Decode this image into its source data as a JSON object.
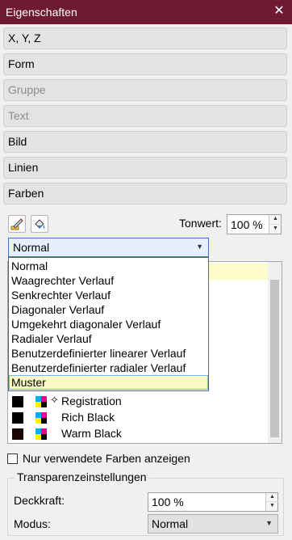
{
  "window": {
    "title": "Eigenschaften",
    "close_glyph": "✕"
  },
  "sections": [
    {
      "label": "X, Y, Z",
      "enabled": true
    },
    {
      "label": "Form",
      "enabled": true
    },
    {
      "label": "Gruppe",
      "enabled": false
    },
    {
      "label": "Text",
      "enabled": false
    },
    {
      "label": "Bild",
      "enabled": true
    },
    {
      "label": "Linien",
      "enabled": true
    },
    {
      "label": "Farben",
      "enabled": true
    }
  ],
  "colors_panel": {
    "tools": [
      {
        "name": "line-color-icon"
      },
      {
        "name": "fill-color-icon"
      }
    ],
    "tonwert": {
      "label": "Tonwert:",
      "value": "100 %"
    },
    "gradient_type": {
      "selected": "Normal",
      "options": [
        "Normal",
        "Waagrechter Verlauf",
        "Senkrechter Verlauf",
        "Diagonaler Verlauf",
        "Umgekehrt diagonaler Verlauf",
        "Radialer Verlauf",
        "Benutzerdefinierter linearer Verlauf",
        "Benutzerdefinierter radialer Verlauf",
        "Muster"
      ],
      "highlighted": "Muster"
    },
    "color_list": [
      {
        "name": "Registration",
        "swatch": "#000000",
        "registration": true,
        "reg_glyph": "✧"
      },
      {
        "name": "Rich Black",
        "swatch": "#000000",
        "registration": false
      },
      {
        "name": "Warm Black",
        "swatch": "#1a0505",
        "registration": false
      }
    ],
    "show_unused": {
      "label": "Nur verwendete Farben anzeigen",
      "checked": false
    }
  },
  "transparency": {
    "legend": "Transparenzeinstellungen",
    "opacity": {
      "label": "Deckkraft:",
      "value": "100 %"
    },
    "mode": {
      "label": "Modus:",
      "value": "Normal"
    }
  },
  "colors": {
    "titlebar": "#6e1a33",
    "highlight": "#fbf8c9",
    "focus_border": "#3f74c4"
  }
}
